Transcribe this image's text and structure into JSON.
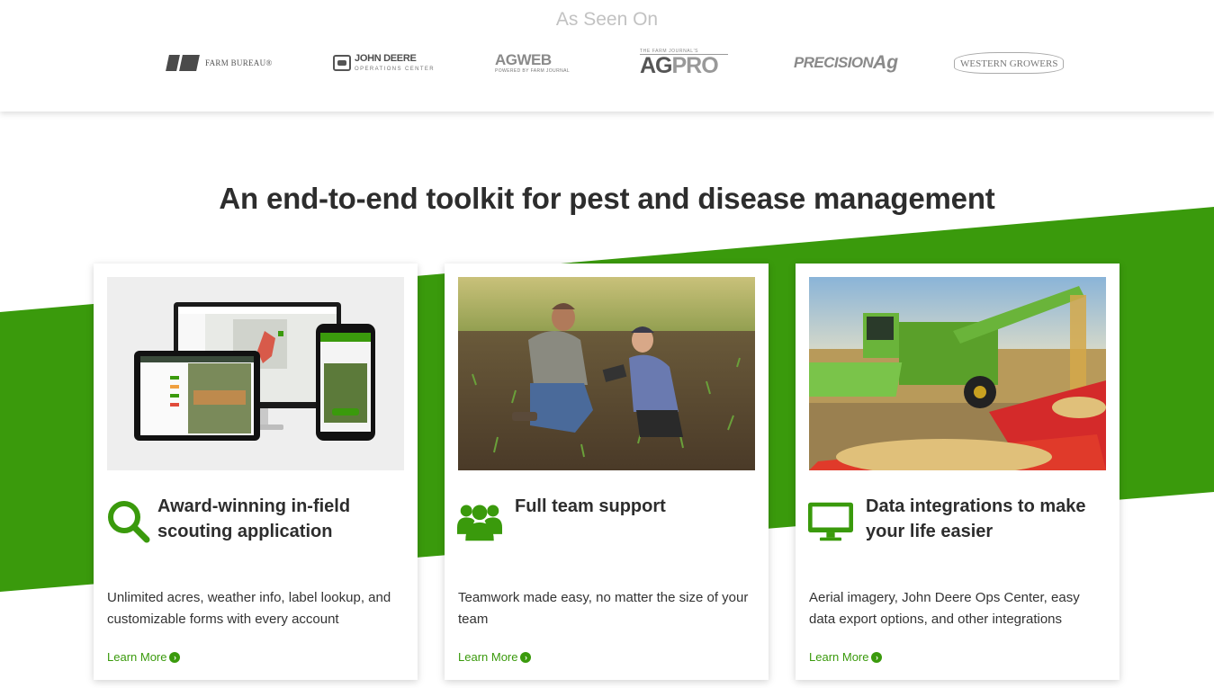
{
  "seen_on": {
    "title": "As Seen On",
    "logos": {
      "farm_bureau": "FARM BUREAU®",
      "john_deere_1": "JOHN DEERE",
      "john_deere_2": "OPERATIONS CENTER",
      "agweb_1": "AGWEB",
      "agweb_2": "POWERED BY FARM JOURNAL",
      "agpro_0": "THE FARM JOURNAL'S",
      "agpro_1": "AG",
      "agpro_2": "PRO",
      "precision_1": "PRECISION",
      "precision_2": "Ag",
      "western_growers": "WESTERN GROWERS"
    }
  },
  "headline": "An end-to-end toolkit for pest and disease management",
  "cards": [
    {
      "title": "Award-winning in-field scouting application",
      "description": "Unlimited acres, weather info, label lookup, and customizable forms with every account",
      "link": "Learn More"
    },
    {
      "title": "Full team support",
      "description": "Teamwork made easy, no matter the size of your team",
      "link": "Learn More"
    },
    {
      "title": "Data integrations to make your life easier",
      "description": "Aerial imagery, John Deere Ops Center, easy data export options, and other integrations",
      "link": "Learn More"
    }
  ],
  "colors": {
    "brand_green": "#3a9a0c",
    "band_green": "#3a9a0c",
    "heading_text": "#2d2d2d"
  }
}
